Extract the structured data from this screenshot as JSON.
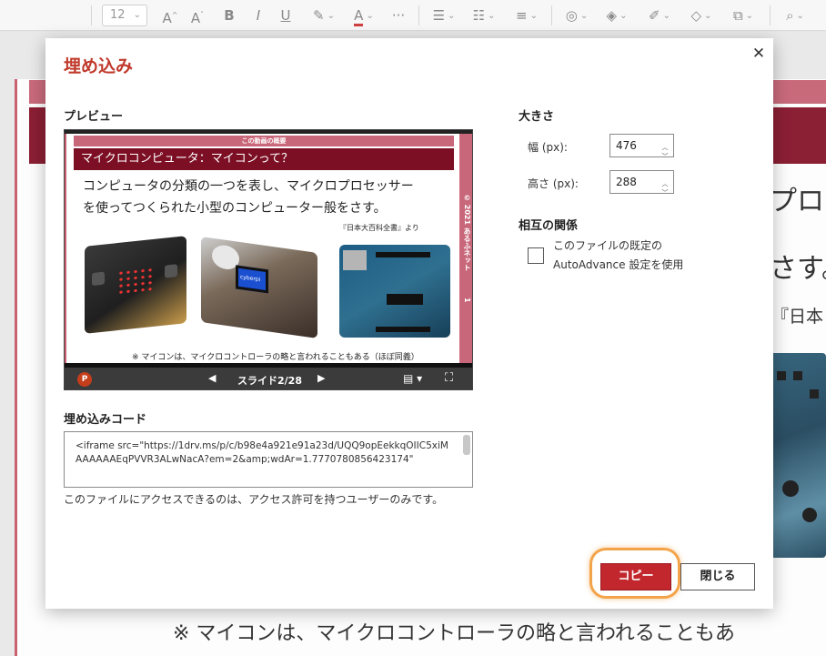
{
  "ribbon": {
    "font_size": "12",
    "icons": [
      "grow-font-icon",
      "shrink-font-icon",
      "bold-icon",
      "italic-icon",
      "underline-icon",
      "highlight-icon",
      "font-color-icon",
      "more-icon",
      "bullets-icon",
      "numbering-icon",
      "align-icon",
      "shapes-icon",
      "fill-icon",
      "outline-icon",
      "effects-icon",
      "arrange-icon",
      "find-icon"
    ]
  },
  "background_slide": {
    "right_text_1": "プロ",
    "right_text_2": "さす。",
    "right_text_3": "『日本",
    "bottom_caption": "※ マイコンは、マイクロコントローラの略と言われることもあ"
  },
  "dialog": {
    "title": "埋め込み",
    "close_symbol": "✕",
    "preview_label": "プレビュー",
    "embed_code_label": "埋め込みコード",
    "size_label": "大きさ",
    "width_label": "幅 (px):",
    "width_value": "476",
    "height_label": "高さ (px):",
    "height_value": "288",
    "interaction_label": "相互の関係",
    "autoadvance_label": "このファイルの既定の AutoAdvance 設定を使用",
    "embed_code": "<iframe src=\"https://1drv.ms/p/c/b98e4a921e91a23d/UQQ9opEekkqOIIC5xiMAAAAAAEqPVVR3ALwNacA?em=2&amp;wdAr=1.7770780856423174\"",
    "access_note": "このファイルにアクセスできるのは、アクセス許可を持つユーザーのみです。",
    "copy_button": "コピー",
    "close_button": "閉じる"
  },
  "preview_slide": {
    "band_top": "この動画の概要",
    "title": "マイクロコンピュータ：マイコンって？",
    "body_line1": "コンピュータの分類の一つを表し、マイクロプロセッサー",
    "body_line2": "を使ってつくられた小型のコンピューター般をさす。",
    "source": "『日本大百科全書』より",
    "side_text": "© 2021 あるふネット",
    "side_page": "1",
    "note": "※ マイコンは、マイクロコントローラの略と言われることもある（ほぼ同義）",
    "device_label": "cyberpi",
    "nav_ppt": "P",
    "nav_prev": "◀",
    "nav_counter": "スライド2/28",
    "nav_next": "▶",
    "nav_notes": "▤ ▾",
    "nav_fullscreen": "⛶"
  }
}
